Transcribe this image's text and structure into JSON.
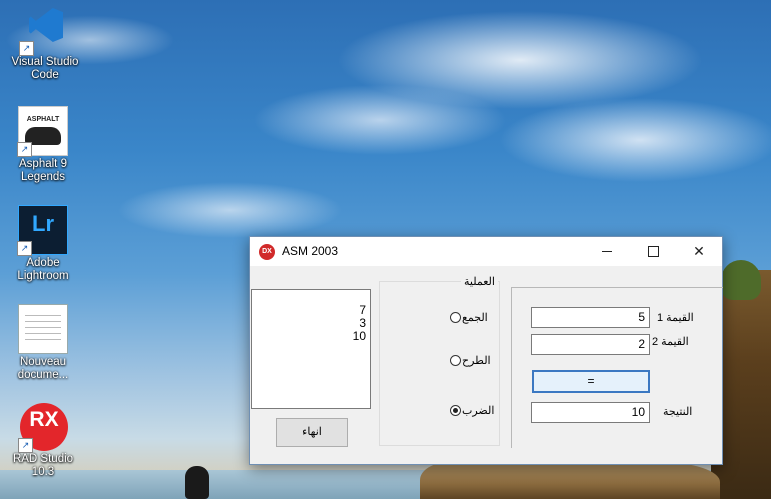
{
  "desktop": {
    "icons": [
      {
        "label": "Visual Studio Code"
      },
      {
        "label": "Asphalt 9 Legends",
        "badge": "ASPHALT"
      },
      {
        "label": "Adobe Lightroom",
        "badge": "Lr"
      },
      {
        "label": "Nouveau docume..."
      },
      {
        "label": "RAD Studio 10.3",
        "badge": "RX"
      }
    ]
  },
  "window": {
    "title": "ASM 2003",
    "app_icon_text": "DX",
    "close_glyph": "✕"
  },
  "memo": {
    "lines": [
      "7",
      "3",
      "10"
    ]
  },
  "exit_button": {
    "label": "انهاء"
  },
  "operation_group": {
    "caption": "العملية",
    "options": [
      {
        "label": "الجمع",
        "checked": false
      },
      {
        "label": "الطرح",
        "checked": false
      },
      {
        "label": "الضرب",
        "checked": true
      }
    ]
  },
  "inputs": {
    "value1": {
      "label": "القيمة 1",
      "value": "5"
    },
    "value2": {
      "label": "القيمة 2",
      "value": "2"
    },
    "equals_button": {
      "label": "="
    },
    "result": {
      "label": "النتيجة",
      "value": "10"
    }
  }
}
